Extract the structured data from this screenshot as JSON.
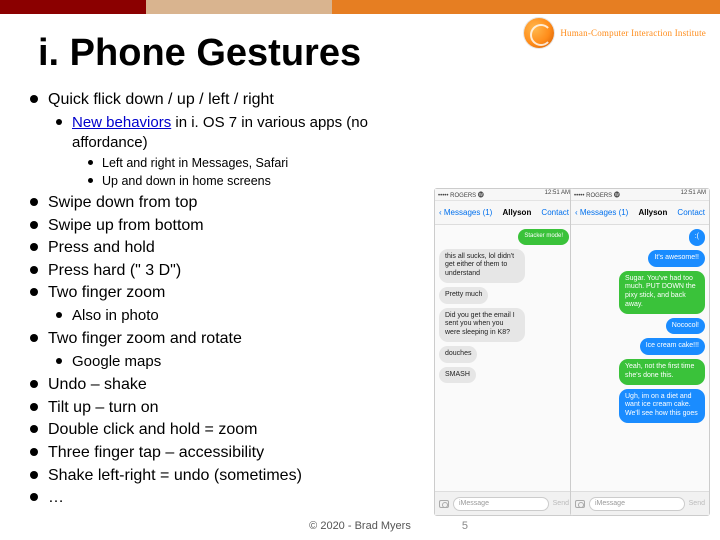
{
  "header": {
    "org": "Human-Computer Interaction Institute"
  },
  "title": "i. Phone Gestures",
  "bullets": {
    "b1": "Quick flick down / up / left / right",
    "b1a_pre": "New behaviors",
    "b1a_post": " in i. OS 7 in various apps (no affordance)",
    "b1a_i": "Left and right in Messages, Safari",
    "b1a_ii": "Up and down in home screens",
    "b2": "Swipe down from top",
    "b3": "Swipe up from bottom",
    "b4": "Press and hold",
    "b5": "Press hard (\" 3 D\")",
    "b6": "Two finger zoom",
    "b6a": "Also in photo",
    "b7": "Two finger zoom and rotate",
    "b7a": "Google maps",
    "b8": "Undo – shake",
    "b9": "Tilt up – turn on",
    "b10": "Double click and hold = zoom",
    "b11": "Three finger tap – accessibility",
    "b12": "Shake left-right = undo (sometimes)",
    "b13": "…"
  },
  "footer": {
    "copyright": "© 2020 - Brad Myers",
    "page": "5"
  },
  "phones": {
    "left": {
      "status_left": "••••• ROGERS 🅦",
      "status_right": "12:51 AM",
      "nav_back": "‹ Messages (1)",
      "nav_title": "Allyson",
      "nav_action": "Contact",
      "stacker": "Stacker mode!",
      "msgs": [
        {
          "side": "in",
          "text": "this all sucks, lol didn't get either of them to understand"
        },
        {
          "side": "in",
          "text": "Pretty much"
        },
        {
          "side": "in",
          "text": "Did you get the email I sent you when you were sleeping in K8?"
        },
        {
          "side": "in",
          "text": "douches"
        },
        {
          "side": "in",
          "text": "SMASH"
        }
      ],
      "compose_ph": "iMessage",
      "send": "Send"
    },
    "right": {
      "status_left": "••••• ROGERS 🅦",
      "status_right": "12:51 AM",
      "nav_back": "‹ Messages (1)",
      "nav_title": "Allyson",
      "nav_action": "Contact",
      "msgs": [
        {
          "side": "out-blue",
          "text": ":("
        },
        {
          "side": "out-blue",
          "text": "It's awesome!!"
        },
        {
          "side": "out-green",
          "text": "Sugar. You've had too much. PUT DOWN the pixy stick, and back away."
        },
        {
          "side": "out-blue",
          "text": "Nococol!"
        },
        {
          "side": "out-blue",
          "text": "Ice cream cake!!!"
        },
        {
          "side": "out-green",
          "text": "Yeah, not the first time she's done this."
        },
        {
          "side": "out-blue",
          "text": "Ugh, im on a diet and want ice cream cake. We'll see how this goes"
        }
      ],
      "compose_ph": "iMessage",
      "send": "Send"
    }
  }
}
